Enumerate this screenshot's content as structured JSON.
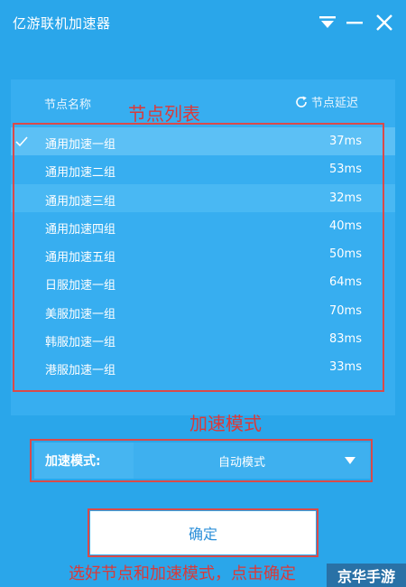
{
  "window": {
    "title": "亿游联机加速器"
  },
  "panel": {
    "column_name": "节点名称",
    "refresh_label": "节点延迟",
    "nodes": [
      {
        "name": "通用加速一组",
        "ping": "37ms"
      },
      {
        "name": "通用加速二组",
        "ping": "53ms"
      },
      {
        "name": "通用加速三组",
        "ping": "32ms"
      },
      {
        "name": "通用加速四组",
        "ping": "40ms"
      },
      {
        "name": "通用加速五组",
        "ping": "50ms"
      },
      {
        "name": "日服加速一组",
        "ping": "64ms"
      },
      {
        "name": "美服加速一组",
        "ping": "70ms"
      },
      {
        "name": "韩服加速一组",
        "ping": "83ms"
      },
      {
        "name": "港服加速一组",
        "ping": "33ms"
      }
    ],
    "selected_node": "通用加速一组"
  },
  "mode": {
    "label": "加速模式:",
    "value": "自动模式"
  },
  "confirm_label": "确定",
  "annotations": {
    "node_list": "节点列表",
    "mode": "加速模式",
    "instruction": "选好节点和加速模式，点击确定"
  },
  "watermark": "京华手游",
  "colors": {
    "background": "#2aa6ea",
    "panel": "#37aef0",
    "selected_row": "#5cc0f5",
    "annotation_red": "#d93a3a",
    "confirm_text": "#2b8fd9"
  }
}
